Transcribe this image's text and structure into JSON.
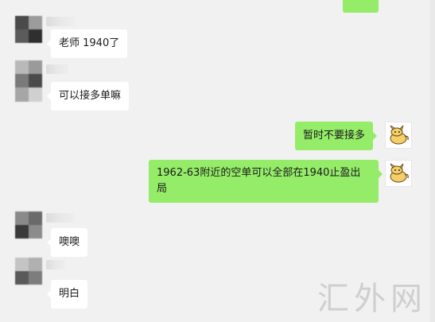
{
  "messages": [
    {
      "side": "left",
      "text": "老师 1940了"
    },
    {
      "side": "left",
      "text": "可以接多单嘛"
    },
    {
      "side": "right",
      "text": "暂时不要接多"
    },
    {
      "side": "right",
      "text": "1962-63附近的空单可以全部在1940止盈出局"
    },
    {
      "side": "left",
      "text": "噢噢"
    },
    {
      "side": "left",
      "text": "明白"
    }
  ],
  "watermark": "汇外网",
  "colors": {
    "background": "#f1f1f1",
    "bubble_left": "#ffffff",
    "bubble_right": "#95ec69",
    "text": "#1a1a1a"
  },
  "icons": {
    "self_avatar": "cartoon-character-icon",
    "contact_avatar": "blurred-avatar"
  }
}
